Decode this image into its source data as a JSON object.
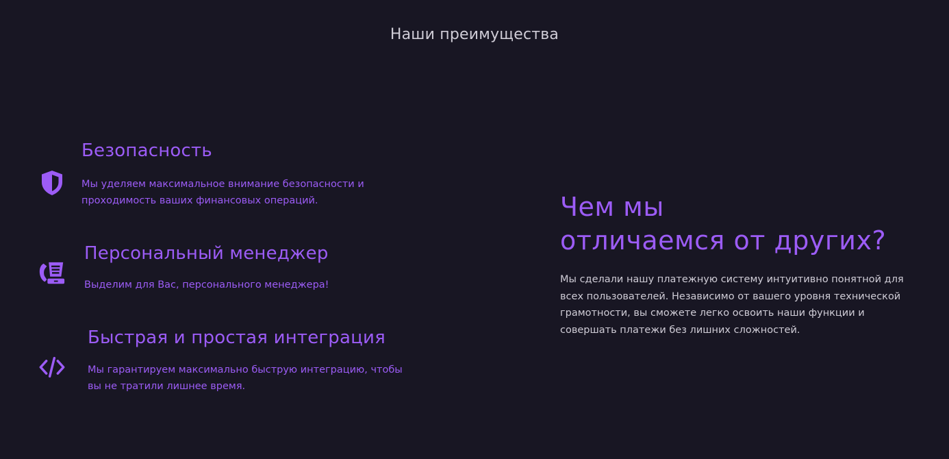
{
  "section_title": "Наши преимущества",
  "colors": {
    "background": "#181623",
    "accent": "#9c5cf6",
    "text_light": "#cfccd6"
  },
  "features": [
    {
      "icon": "shield-icon",
      "title": "Безопасность",
      "desc_lines": [
        "Мы уделяем максимальное внимание безопасности и",
        "проходимость ваших финансовых операций."
      ]
    },
    {
      "icon": "manager-phone-icon",
      "title": "Персональный менеджер",
      "desc_lines": [
        "Выделим для Вас, персонального менеджера!"
      ]
    },
    {
      "icon": "code-icon",
      "title": "Быстрая и простая интеграция",
      "desc_lines": [
        "Мы гарантируем максимально быструю интеграцию, чтобы",
        "вы не тратили лишнее время."
      ]
    }
  ],
  "difference": {
    "heading_lines": [
      "Чем мы",
      "отличаемся от других?"
    ],
    "text_lines": [
      "Мы сделали нашу платежную систему интуитивно понятной для",
      "всех пользователей. Независимо от вашего уровня технической",
      "грамотности, вы сможете легко освоить наши функции и",
      "совершать платежи без лишних сложностей."
    ]
  }
}
